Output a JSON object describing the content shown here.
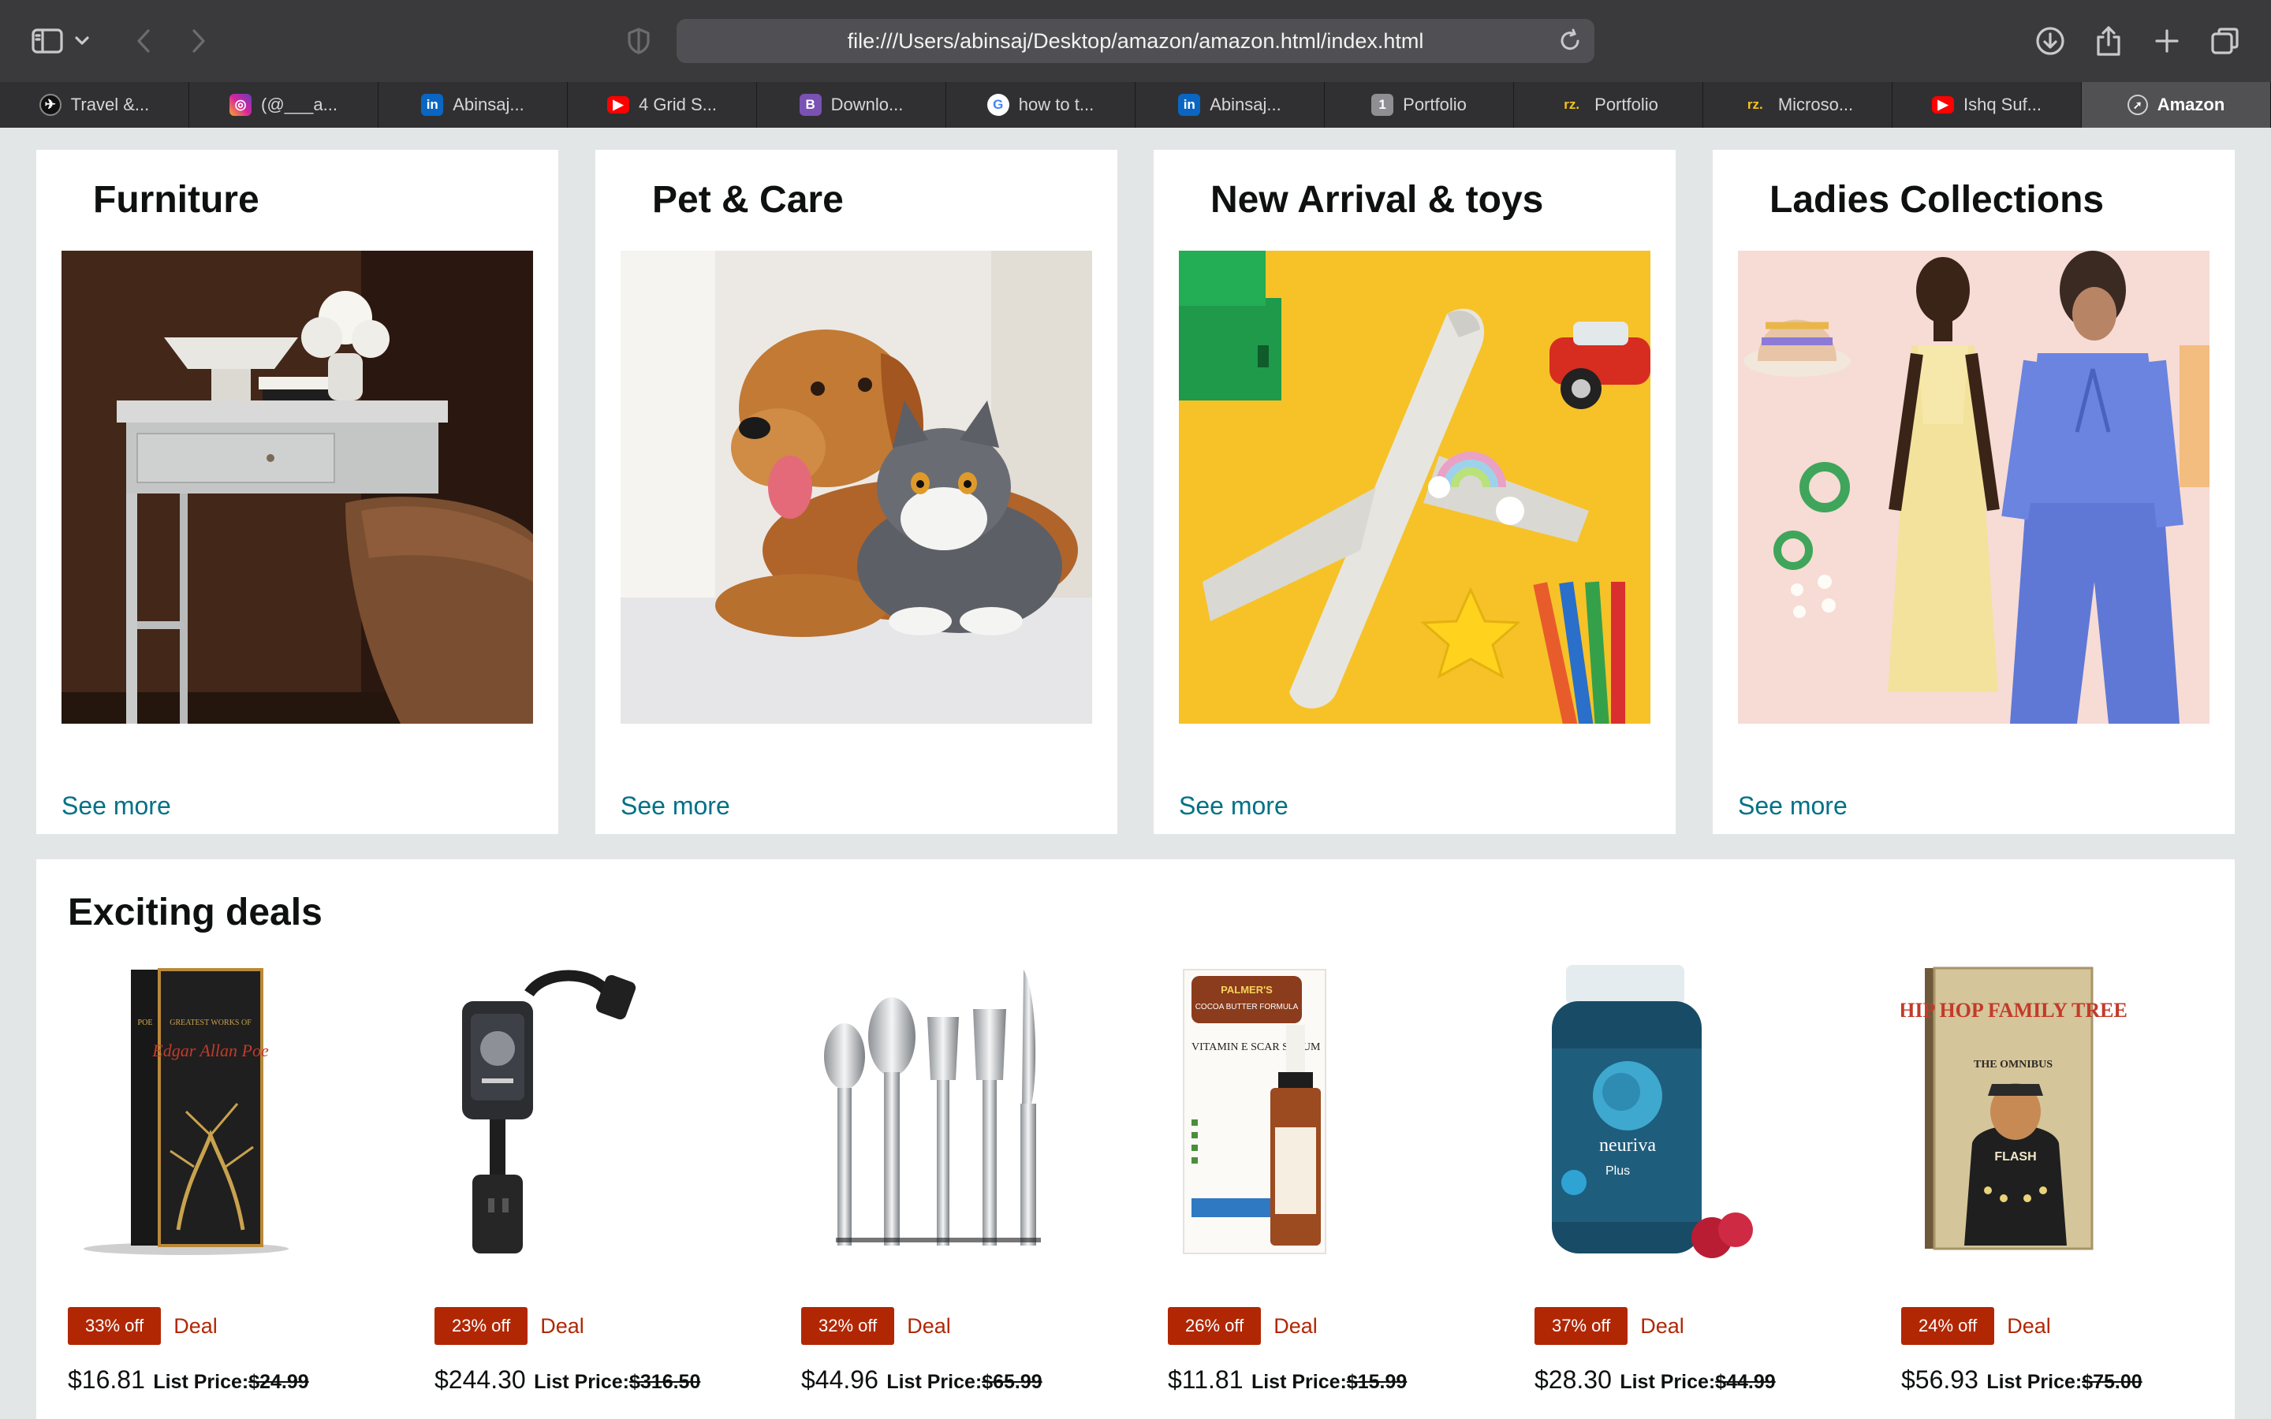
{
  "browser": {
    "url": "file:///Users/abinsaj/Desktop/amazon/amazon.html/index.html",
    "tabs": [
      {
        "label": "Travel &...",
        "icon": "travel-site-icon",
        "color": "#111111"
      },
      {
        "label": "(@___a...",
        "icon": "instagram-icon",
        "color": "#d6249f"
      },
      {
        "label": "Abinsaj...",
        "icon": "linkedin-icon",
        "color": "#0a66c2"
      },
      {
        "label": "4 Grid S...",
        "icon": "youtube-icon",
        "color": "#ff0000"
      },
      {
        "label": "Downlo...",
        "icon": "bootstrap-icon",
        "color": "#7952b3"
      },
      {
        "label": "how to t...",
        "icon": "google-icon",
        "color": "#4285f4"
      },
      {
        "label": "Abinsaj...",
        "icon": "linkedin-icon",
        "color": "#0a66c2"
      },
      {
        "label": "Portfolio",
        "icon": "portfolio-1-icon",
        "color": "#8e8e93"
      },
      {
        "label": "Portfolio",
        "icon": "rz-icon",
        "color": "#f5c518"
      },
      {
        "label": "Microso...",
        "icon": "rz-icon",
        "color": "#f5c518"
      },
      {
        "label": "Ishq Suf...",
        "icon": "youtube-icon",
        "color": "#ff0000"
      },
      {
        "label": "Amazon",
        "icon": "compass-icon",
        "color": "#d0d0d0"
      }
    ]
  },
  "categories": [
    {
      "title": "Furniture",
      "link": "See more",
      "image": "furniture-desk-image"
    },
    {
      "title": "Pet & Care",
      "link": "See more",
      "image": "dog-and-cat-image"
    },
    {
      "title": "New Arrival & toys",
      "link": "See more",
      "image": "toys-image"
    },
    {
      "title": "Ladies Collections",
      "link": "See more",
      "image": "ladies-fashion-image"
    }
  ],
  "deals": {
    "title": "Exciting deals",
    "list_price_label": "List Price:",
    "items": [
      {
        "discount": "33% off",
        "tag": "Deal",
        "price": "$16.81",
        "list_price": "$24.99",
        "image": "edgar-allan-poe-book"
      },
      {
        "discount": "23% off",
        "tag": "Deal",
        "price": "$244.30",
        "list_price": "$316.50",
        "image": "surge-protector"
      },
      {
        "discount": "32% off",
        "tag": "Deal",
        "price": "$44.96",
        "list_price": "$65.99",
        "image": "flatware-set"
      },
      {
        "discount": "26% off",
        "tag": "Deal",
        "price": "$11.81",
        "list_price": "$15.99",
        "image": "scar-serum"
      },
      {
        "discount": "37% off",
        "tag": "Deal",
        "price": "$28.30",
        "list_price": "$44.99",
        "image": "neuriva-supplement"
      },
      {
        "discount": "24% off",
        "tag": "Deal",
        "price": "$56.93",
        "list_price": "$75.00",
        "image": "hip-hop-family-tree-book"
      }
    ],
    "product_text": {
      "poe_series": "GREATEST WORKS OF",
      "poe_name": "Edgar Allan Poe",
      "serum_brand": "PALMER'S",
      "serum_line": "COCOA BUTTER FORMULA",
      "serum_name": "VITAMIN E SCAR SERUM",
      "neuriva_brand": "neuriva",
      "neuriva_variant": "Plus",
      "hiphop_title": "HIP HOP FAMILY TREE",
      "hiphop_sub": "THE OMNIBUS",
      "hiphop_flash": "FLASH"
    }
  },
  "colors": {
    "deal_red": "#b12704",
    "link_teal": "#007185",
    "page_bg": "#e3e6e6"
  }
}
